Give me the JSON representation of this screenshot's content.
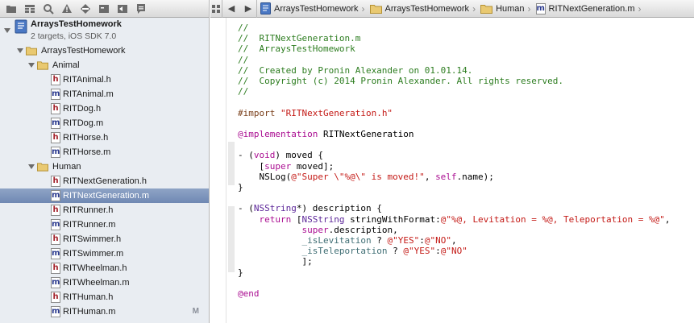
{
  "navigator": {
    "toolbar_icons": [
      "folder-icon",
      "hierarchy-icon",
      "search-icon",
      "warning-icon",
      "breakpoint-icon",
      "tests-icon",
      "debug-icon",
      "log-icon"
    ],
    "project": {
      "name": "ArraysTestHomework",
      "subtitle": "2 targets, iOS SDK 7.0"
    },
    "groups": {
      "root": "ArraysTestHomework",
      "animal": "Animal",
      "human": "Human"
    },
    "files": [
      {
        "name": "RITAnimal.h",
        "type": "h"
      },
      {
        "name": "RITAnimal.m",
        "type": "m"
      },
      {
        "name": "RITDog.h",
        "type": "h"
      },
      {
        "name": "RITDog.m",
        "type": "m"
      },
      {
        "name": "RITHorse.h",
        "type": "h"
      },
      {
        "name": "RITHorse.m",
        "type": "m"
      },
      {
        "name": "RITNextGeneration.h",
        "type": "h"
      },
      {
        "name": "RITNextGeneration.m",
        "type": "m"
      },
      {
        "name": "RITRunner.h",
        "type": "h"
      },
      {
        "name": "RITRunner.m",
        "type": "m"
      },
      {
        "name": "RITSwimmer.h",
        "type": "h"
      },
      {
        "name": "RITSwimmer.m",
        "type": "m"
      },
      {
        "name": "RITWheelman.h",
        "type": "h"
      },
      {
        "name": "RITWheelman.m",
        "type": "m"
      },
      {
        "name": "RITHuman.h",
        "type": "h"
      },
      {
        "name": "RITHuman.m",
        "type": "m",
        "badge": "M"
      }
    ]
  },
  "jumpbar": {
    "back": "◀",
    "forward": "▶",
    "crumbs": [
      "ArraysTestHomework",
      "ArraysTestHomework",
      "Human",
      "RITNextGeneration.m"
    ]
  },
  "code": {
    "lines": [
      [
        {
          "t": "//",
          "c": "comment"
        }
      ],
      [
        {
          "t": "//  RITNextGeneration.m",
          "c": "comment"
        }
      ],
      [
        {
          "t": "//  ArraysTestHomework",
          "c": "comment"
        }
      ],
      [
        {
          "t": "//",
          "c": "comment"
        }
      ],
      [
        {
          "t": "//  Created by Pronin Alexander on 01.01.14.",
          "c": "comment"
        }
      ],
      [
        {
          "t": "//  Copyright (c) 2014 Pronin Alexander. All rights reserved.",
          "c": "comment"
        }
      ],
      [
        {
          "t": "//",
          "c": "comment"
        }
      ],
      [],
      [
        {
          "t": "#import ",
          "c": "pre"
        },
        {
          "t": "\"RITNextGeneration.h\"",
          "c": "str"
        }
      ],
      [],
      [
        {
          "t": "@implementation",
          "c": "kw"
        },
        {
          "t": " RITNextGeneration",
          "c": "plain"
        }
      ],
      [],
      [
        {
          "t": "- (",
          "c": "plain"
        },
        {
          "t": "void",
          "c": "kw"
        },
        {
          "t": ") moved {",
          "c": "plain"
        }
      ],
      [
        {
          "t": "    [",
          "c": "plain"
        },
        {
          "t": "super",
          "c": "kw"
        },
        {
          "t": " moved];",
          "c": "plain"
        }
      ],
      [
        {
          "t": "    NSLog(",
          "c": "plain"
        },
        {
          "t": "@\"Super \\\"%@\\\" is moved!\"",
          "c": "str"
        },
        {
          "t": ", ",
          "c": "plain"
        },
        {
          "t": "self",
          "c": "kw"
        },
        {
          "t": ".name);",
          "c": "plain"
        }
      ],
      [
        {
          "t": "}",
          "c": "plain"
        }
      ],
      [],
      [
        {
          "t": "- (",
          "c": "plain"
        },
        {
          "t": "NSString",
          "c": "cls"
        },
        {
          "t": "*) description {",
          "c": "plain"
        }
      ],
      [
        {
          "t": "    ",
          "c": "plain"
        },
        {
          "t": "return",
          "c": "kw"
        },
        {
          "t": " [",
          "c": "plain"
        },
        {
          "t": "NSString",
          "c": "cls"
        },
        {
          "t": " stringWithFormat:",
          "c": "plain"
        },
        {
          "t": "@\"%@, Levitation = %@, Teleportation = %@\"",
          "c": "str"
        },
        {
          "t": ",",
          "c": "plain"
        }
      ],
      [
        {
          "t": "            ",
          "c": "plain"
        },
        {
          "t": "super",
          "c": "kw"
        },
        {
          "t": ".description,",
          "c": "plain"
        }
      ],
      [
        {
          "t": "            ",
          "c": "plain"
        },
        {
          "t": "_isLevitation",
          "c": "ivar"
        },
        {
          "t": " ? ",
          "c": "plain"
        },
        {
          "t": "@\"YES\"",
          "c": "str"
        },
        {
          "t": ":",
          "c": "plain"
        },
        {
          "t": "@\"NO\"",
          "c": "str"
        },
        {
          "t": ",",
          "c": "plain"
        }
      ],
      [
        {
          "t": "            ",
          "c": "plain"
        },
        {
          "t": "_isTeleportation",
          "c": "ivar"
        },
        {
          "t": " ? ",
          "c": "plain"
        },
        {
          "t": "@\"YES\"",
          "c": "str"
        },
        {
          "t": ":",
          "c": "plain"
        },
        {
          "t": "@\"NO\"",
          "c": "str"
        }
      ],
      [
        {
          "t": "            ];",
          "c": "plain"
        }
      ],
      [
        {
          "t": "}",
          "c": "plain"
        }
      ],
      [],
      [
        {
          "t": "@end",
          "c": "kw"
        }
      ]
    ]
  }
}
